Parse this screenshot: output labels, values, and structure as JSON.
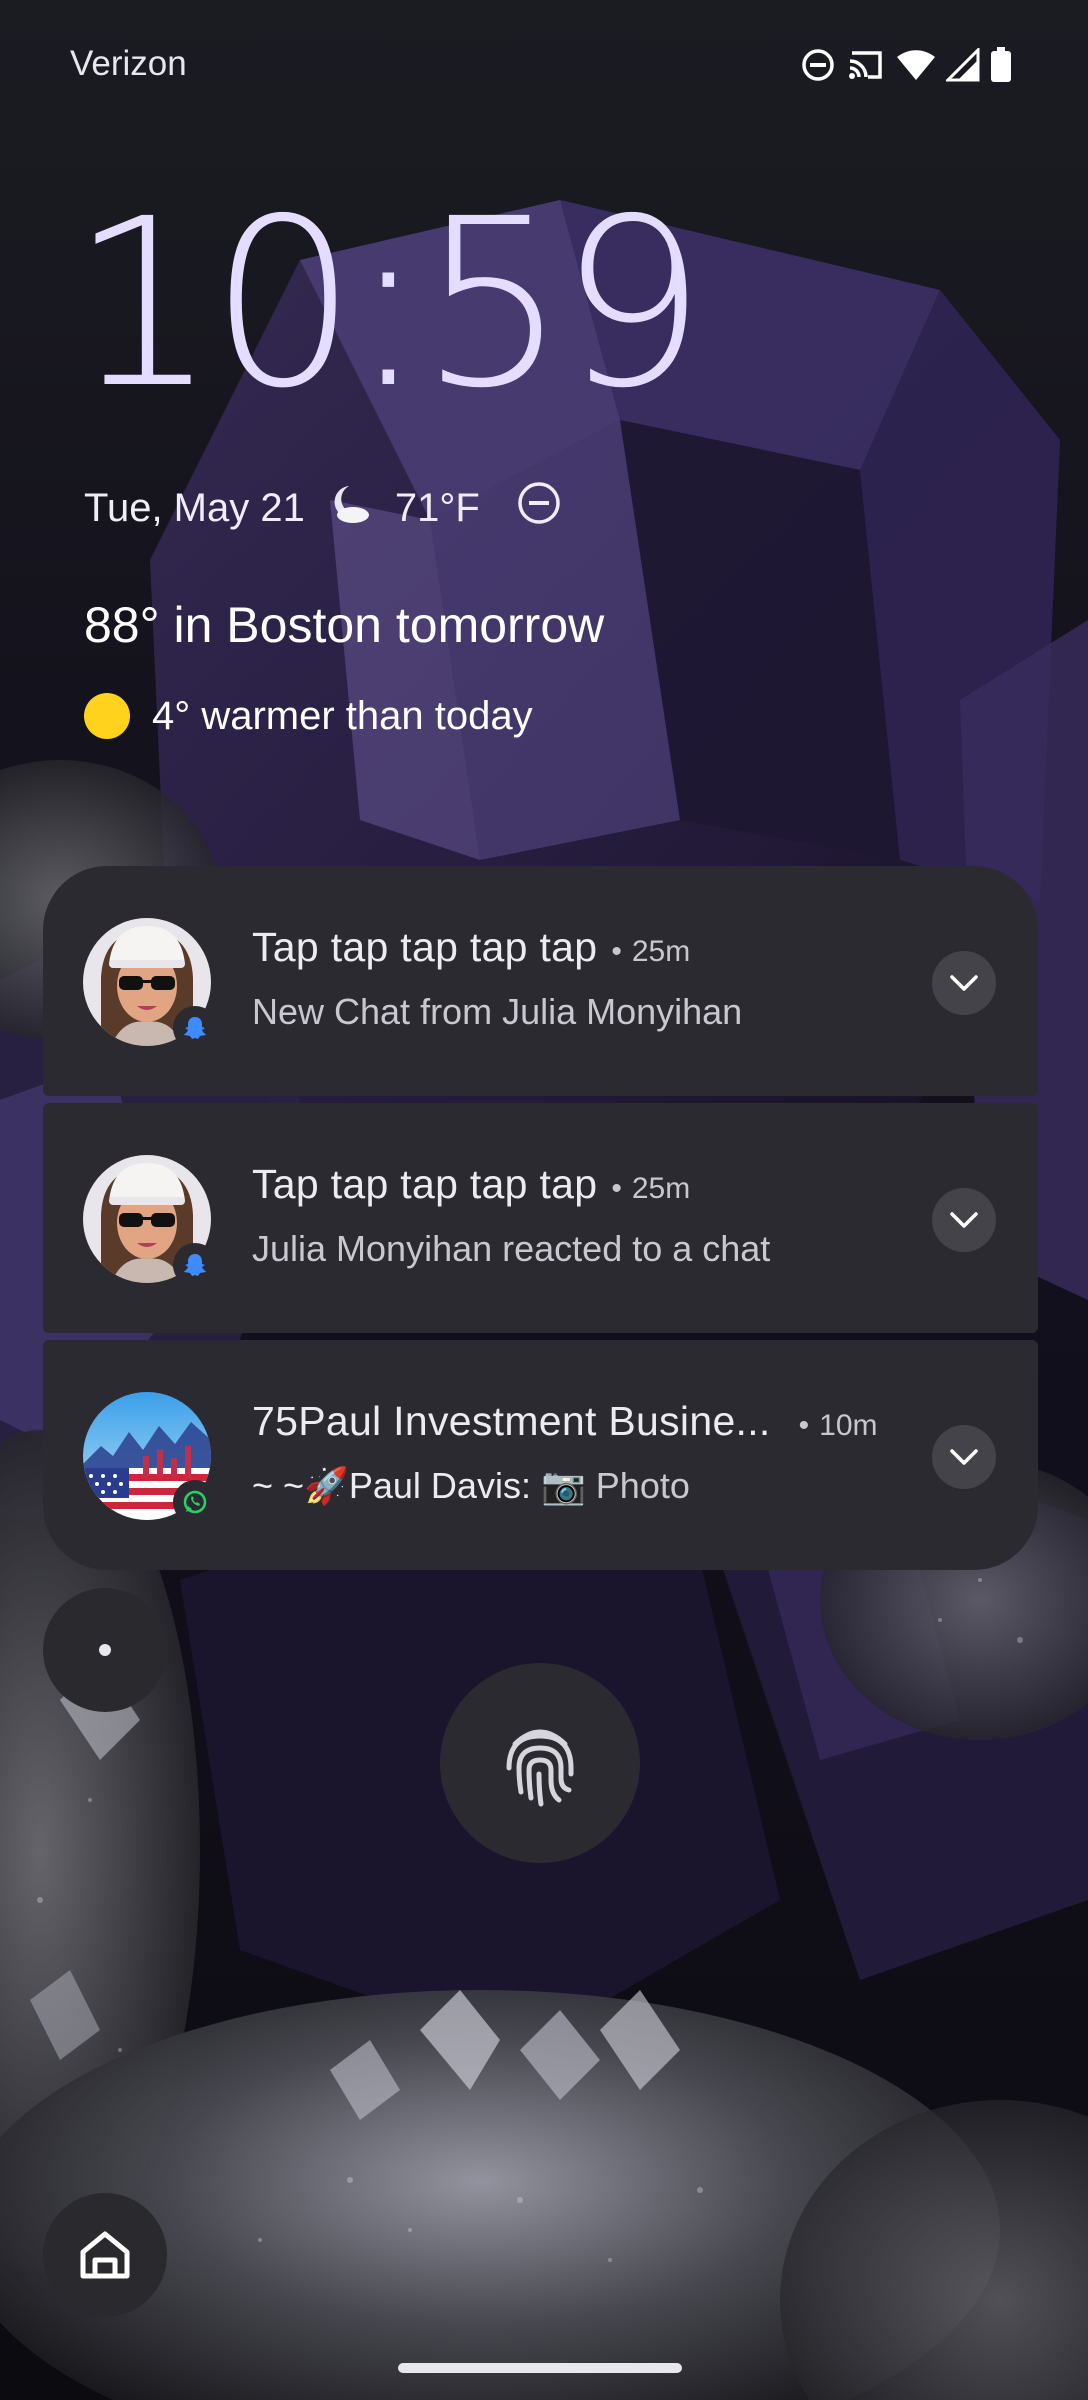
{
  "status_bar": {
    "carrier": "Verizon",
    "icons": [
      "do-not-disturb-icon",
      "cast-icon",
      "wifi-icon",
      "cell-signal-icon",
      "battery-icon"
    ]
  },
  "lockscreen": {
    "time": "10:59",
    "date": "Tue, May 21",
    "current_temp": "71°F",
    "weather_tomorrow": "88° in Boston tomorrow",
    "weather_compare": "4° warmer than today"
  },
  "notifications": [
    {
      "title": "Tap tap tap tap tap",
      "time": "25m",
      "body": "New Chat from Julia Monyihan",
      "app": "snapchat-icon"
    },
    {
      "title": "Tap tap tap tap tap",
      "time": "25m",
      "body": "Julia Monyihan reacted to a chat",
      "app": "snapchat-icon"
    },
    {
      "title": "75Paul Investment Busine...",
      "time": "10m",
      "body_sender": "~ ~🚀Paul Davis:",
      "body_text": "📷 Photo",
      "app": "whatsapp-icon"
    }
  ],
  "separator": "•",
  "colors": {
    "clock": "#e5ddff",
    "notification_bg": "#2b2a30",
    "sun": "#ffd21e",
    "snapchat_badge": "#3d8bff",
    "whatsapp_badge": "#25d366"
  }
}
